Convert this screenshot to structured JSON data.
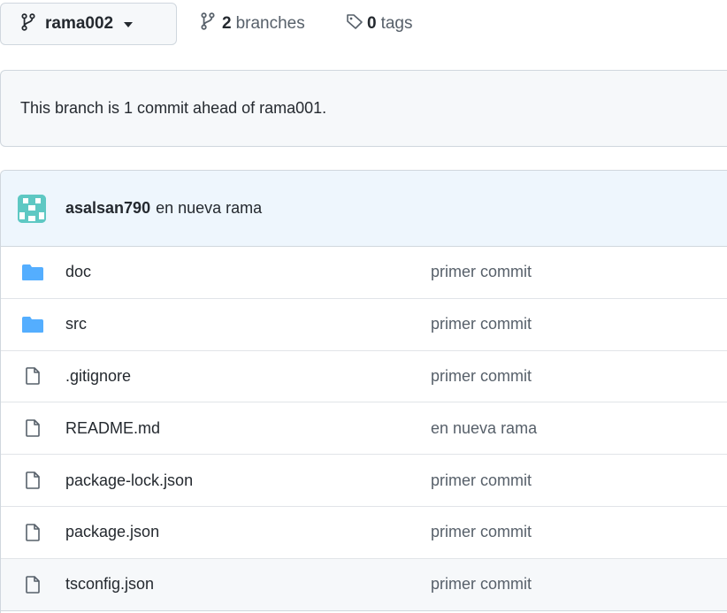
{
  "toolbar": {
    "branch_name": "rama002",
    "branches_count": "2",
    "branches_label": "branches",
    "tags_count": "0",
    "tags_label": "tags"
  },
  "notice": {
    "text": "This branch is 1 commit ahead of rama001."
  },
  "latest_commit": {
    "author": "asalsan790",
    "message": "en nueva rama"
  },
  "files": [
    {
      "name": "doc",
      "type": "folder",
      "commit": "primer commit"
    },
    {
      "name": "src",
      "type": "folder",
      "commit": "primer commit"
    },
    {
      "name": ".gitignore",
      "type": "file",
      "commit": "primer commit"
    },
    {
      "name": "README.md",
      "type": "file",
      "commit": "en nueva rama"
    },
    {
      "name": "package-lock.json",
      "type": "file",
      "commit": "primer commit"
    },
    {
      "name": "package.json",
      "type": "file",
      "commit": "primer commit"
    },
    {
      "name": "tsconfig.json",
      "type": "file",
      "commit": "primer commit"
    }
  ],
  "colors": {
    "folder": "#54aeff",
    "avatar": "#5ec8c3",
    "link_muted": "#57606a",
    "header_bg": "#eef6fd"
  }
}
